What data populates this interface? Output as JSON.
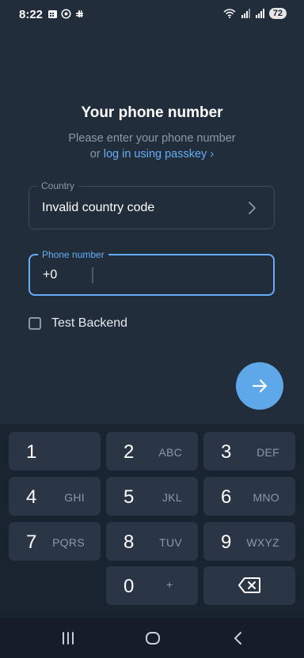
{
  "status_bar": {
    "time": "8:22",
    "battery": "72",
    "icons": [
      "calendar-icon",
      "whatsapp-icon",
      "slack-icon",
      "wifi-icon",
      "signal-icon",
      "signal-r-icon"
    ]
  },
  "screen": {
    "title": "Your phone number",
    "subtitle_line1": "Please enter your phone number",
    "subtitle_or": "or",
    "passkey_link": "log in using passkey",
    "passkey_chevron": "›"
  },
  "country_field": {
    "label": "Country",
    "value": "Invalid country code"
  },
  "phone_field": {
    "label": "Phone number",
    "code": "+0",
    "number": ""
  },
  "test_backend": {
    "label": "Test Backend",
    "checked": false
  },
  "keypad": {
    "keys": [
      {
        "digit": "1",
        "letters": ""
      },
      {
        "digit": "2",
        "letters": "ABC"
      },
      {
        "digit": "3",
        "letters": "DEF"
      },
      {
        "digit": "4",
        "letters": "GHI"
      },
      {
        "digit": "5",
        "letters": "JKL"
      },
      {
        "digit": "6",
        "letters": "MNO"
      },
      {
        "digit": "7",
        "letters": "PQRS"
      },
      {
        "digit": "8",
        "letters": "TUV"
      },
      {
        "digit": "9",
        "letters": "WXYZ"
      },
      {
        "digit": "0",
        "letters": "+"
      }
    ]
  },
  "colors": {
    "background": "#212d3b",
    "accent": "#66adf5",
    "fab": "#5ea7e8",
    "key": "#2a3646"
  }
}
